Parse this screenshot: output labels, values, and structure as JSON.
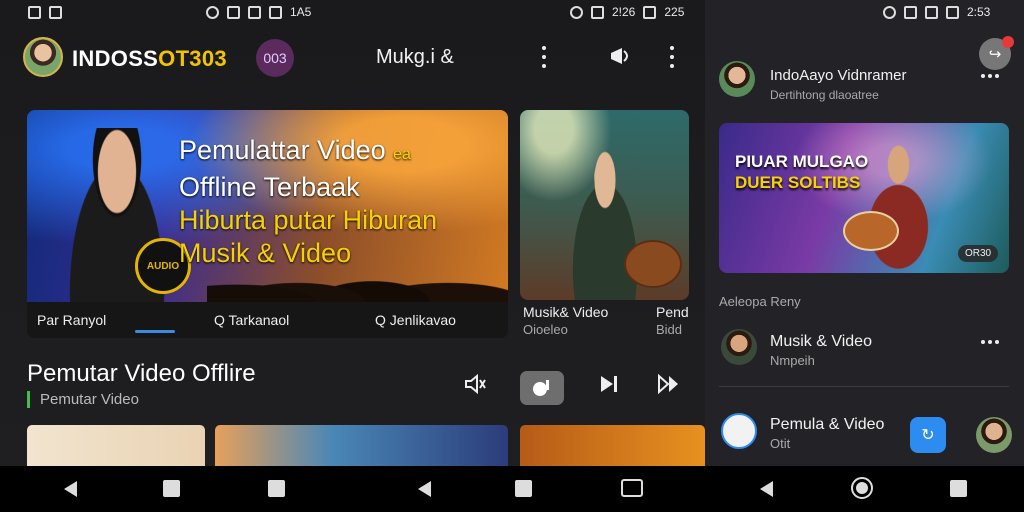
{
  "status_left": {
    "time": "1A5",
    "time_right": "2!26",
    "clock2": "225"
  },
  "status_right": {
    "time": "2:53"
  },
  "header": {
    "brand_white": "INDOSS",
    "brand_yellow": "OT303",
    "pill": "003",
    "title": "Mukg.i &"
  },
  "hero": {
    "line1": "Pemulattar Video",
    "line1_badge": "ea",
    "line2": "Offline Terbaak",
    "line3": "Hiburta putar Hiburan",
    "line4": "Musik & Video",
    "badge": "AUDIO",
    "bar": [
      "Par Ranyol",
      "Q Tarkanaol",
      "Q Jenlikavao"
    ]
  },
  "side_card": {
    "caption": "Musik& Video",
    "sub": "Oioeleo",
    "caption2": "Pend",
    "sub2": "Bidd"
  },
  "section": {
    "title": "Pemutar Video Offlire",
    "subtitle": "Pemutar Video"
  },
  "right": {
    "title": "IndoAayo Vidnramer",
    "subtitle": "Dertihtong dlaoatree",
    "card_line1": "PIUAR MULGAO",
    "card_line2": "DUER SOLTIBS",
    "duration": "OR30",
    "section_label": "Aeleopa Reny",
    "items": [
      {
        "title": "Musik & Video",
        "sub": "Nmpeih"
      },
      {
        "title": "Pemula & Video",
        "sub": "Otit"
      }
    ]
  },
  "colors": {
    "accent": "#f2c400",
    "pill_bg": "#5a2b5c",
    "fab": "#2d8cf0",
    "section_bar": "#3cc24a"
  }
}
